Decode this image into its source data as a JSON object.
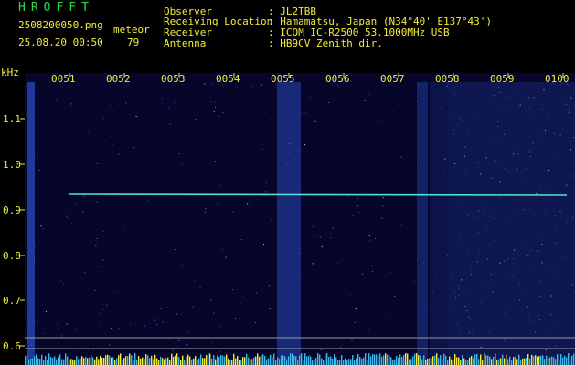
{
  "app": {
    "title": "HROFFT",
    "filename": "2508200050.png",
    "datetime": "25.08.20 00:50",
    "meteor_label": "meteor",
    "meteor_count": "79"
  },
  "station": {
    "fields": [
      {
        "label": "Observer",
        "value": ": JL2TBB"
      },
      {
        "label": "Receiving Location",
        "value": ": Hamamatsu, Japan (N34°40' E137°43')"
      },
      {
        "label": "Receiver",
        "value": ": ICOM IC-R2500 53.1000MHz USB"
      },
      {
        "label": "Antenna",
        "value": ": HB9CV Zenith dir."
      }
    ]
  },
  "axis": {
    "y_unit": "kHz",
    "y_ticks": [
      "1.1",
      "1.0",
      "0.9",
      "0.8",
      "0.7",
      "0.6"
    ],
    "x_ticks": [
      "0051",
      "0052",
      "0053",
      "0054",
      "0055",
      "0056",
      "0057",
      "0058",
      "0059",
      "0100"
    ]
  },
  "colors": {
    "text_green": "#2fd64a",
    "text_yellow": "#f2ec3a",
    "signal_line": "#4be0d0",
    "background": "#000000"
  }
}
